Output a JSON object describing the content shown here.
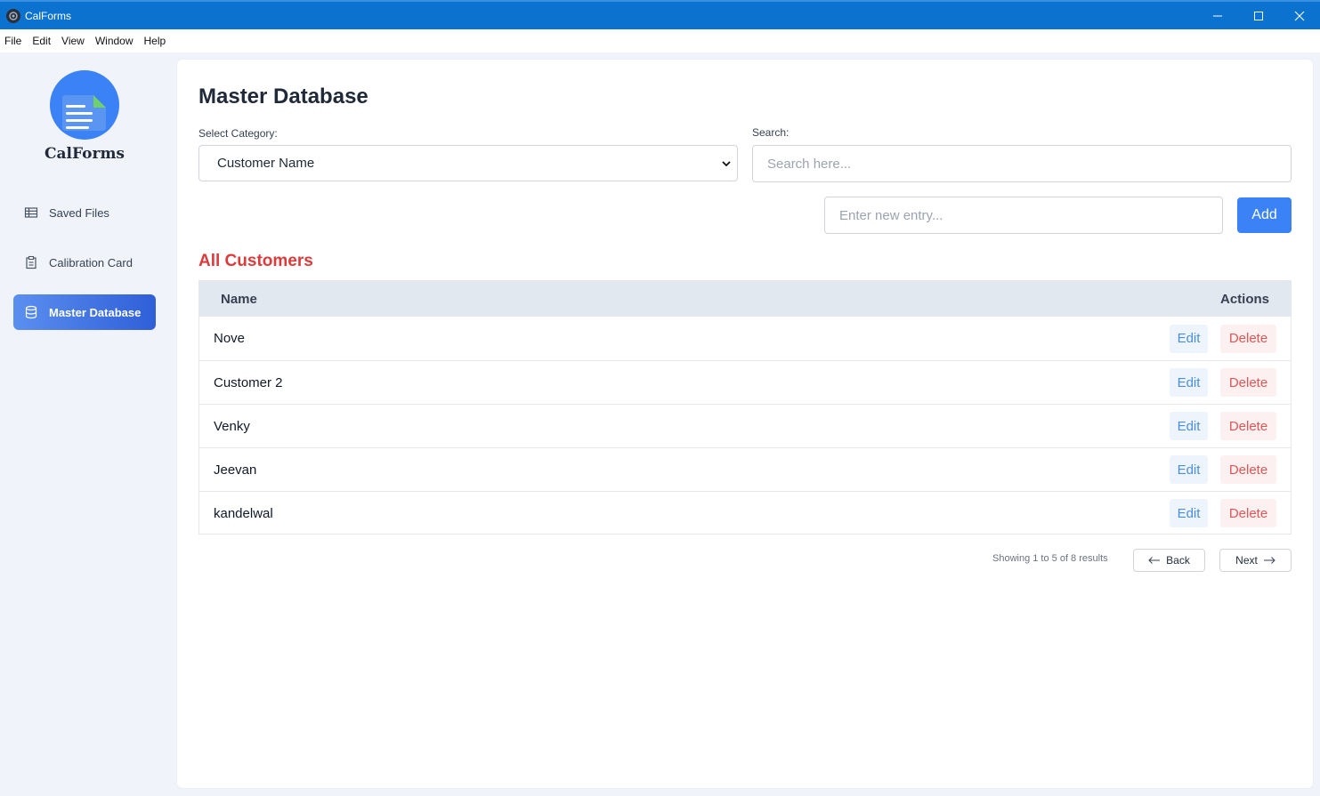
{
  "window": {
    "title": "CalForms",
    "controls": [
      "minimize-icon",
      "maximize-icon",
      "close-icon"
    ]
  },
  "menu": {
    "items": [
      "File",
      "Edit",
      "View",
      "Window",
      "Help"
    ]
  },
  "sidebar": {
    "brand": "CalForms",
    "items": [
      {
        "label": "Saved Files",
        "icon": "table-icon",
        "active": false
      },
      {
        "label": "Calibration Card",
        "icon": "clipboard-icon",
        "active": false
      },
      {
        "label": "Master Database",
        "icon": "database-icon",
        "active": true
      }
    ]
  },
  "main": {
    "title": "Master Database",
    "category_label": "Select Category:",
    "category_value": "Customer Name",
    "search_label": "Search:",
    "search_placeholder": "Search here...",
    "new_entry_placeholder": "Enter new entry...",
    "add_label": "Add",
    "section_title": "All Customers",
    "table": {
      "headers": [
        "Name",
        "Actions"
      ],
      "rows": [
        {
          "name": "Nove"
        },
        {
          "name": "Customer 2"
        },
        {
          "name": "Venky"
        },
        {
          "name": "Jeevan"
        },
        {
          "name": "kandelwal"
        }
      ],
      "edit_label": "Edit",
      "delete_label": "Delete"
    },
    "pagination": {
      "summary": "Showing 1 to 5 of 8 results",
      "back_label": "Back",
      "next_label": "Next"
    }
  },
  "colors": {
    "titlebar": "#0b72d0",
    "accent": "#3b82f6",
    "section_title": "#dc3b3b"
  }
}
